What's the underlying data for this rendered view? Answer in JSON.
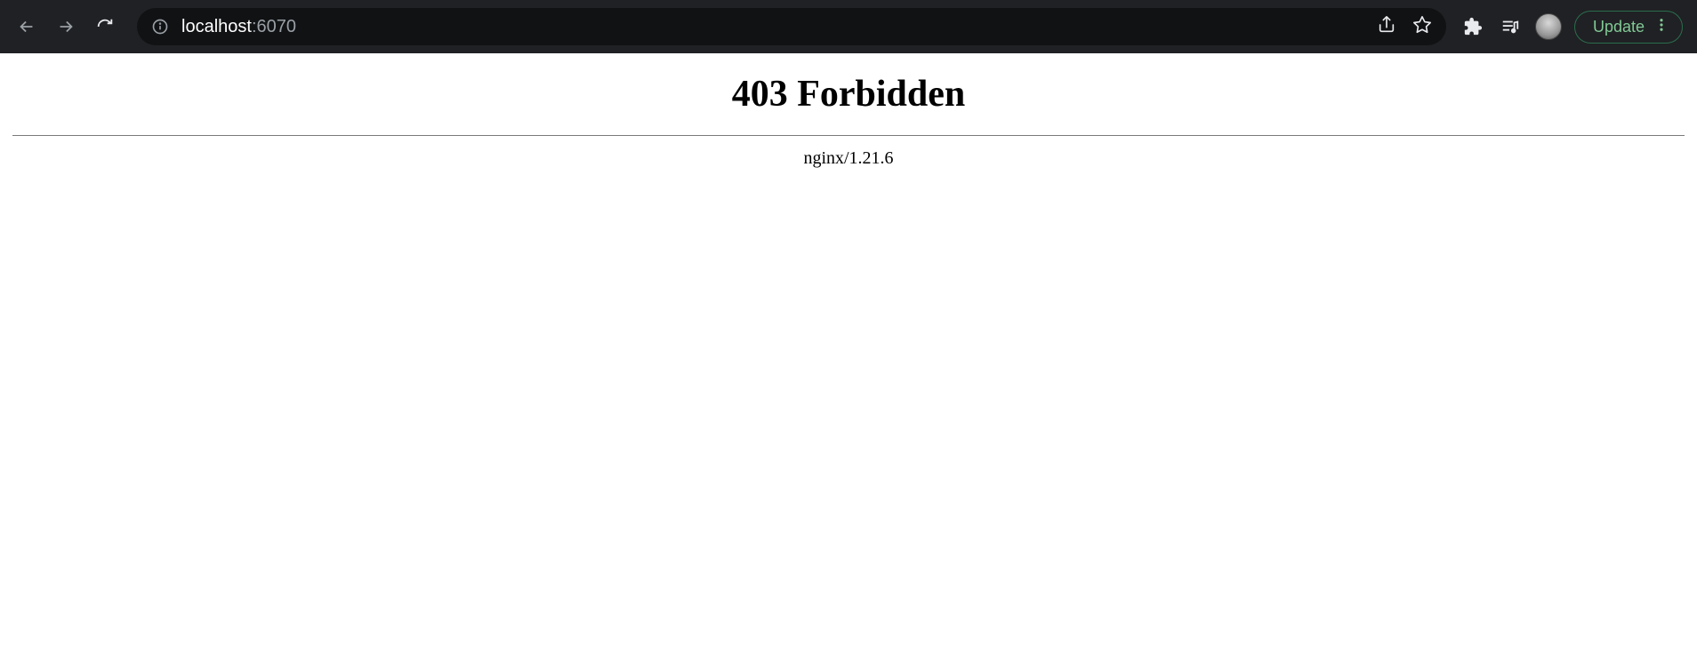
{
  "browser": {
    "url_host": "localhost",
    "url_port": ":6070",
    "update_label": "Update"
  },
  "page": {
    "heading": "403 Forbidden",
    "server": "nginx/1.21.6"
  }
}
